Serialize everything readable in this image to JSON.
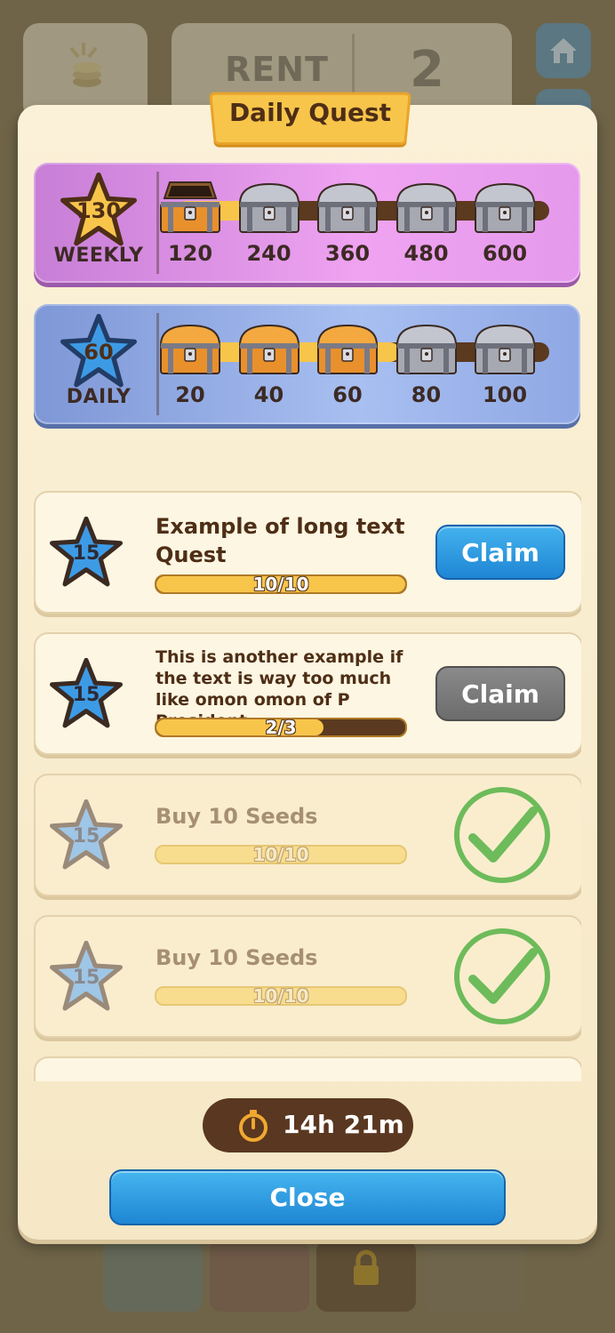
{
  "background": {
    "rent_label": "RENT",
    "rent_value": "2"
  },
  "modal": {
    "title": "Daily Quest",
    "weekly": {
      "points": "130",
      "label": "WEEKLY",
      "progress_fraction": 0.2,
      "milestones": [
        {
          "value": "120",
          "chest": "open"
        },
        {
          "value": "240",
          "chest": "silver"
        },
        {
          "value": "360",
          "chest": "silver"
        },
        {
          "value": "480",
          "chest": "silver"
        },
        {
          "value": "600",
          "chest": "silver"
        }
      ]
    },
    "daily": {
      "points": "60",
      "label": "DAILY",
      "progress_fraction": 0.6,
      "milestones": [
        {
          "value": "20",
          "chest": "gold"
        },
        {
          "value": "40",
          "chest": "gold"
        },
        {
          "value": "60",
          "chest": "gold"
        },
        {
          "value": "80",
          "chest": "silver"
        },
        {
          "value": "100",
          "chest": "silver"
        }
      ]
    },
    "quests": [
      {
        "reward": "15",
        "title": "Example of long text Quest",
        "progress": "10/10",
        "progress_fraction": 1.0,
        "state": "claimable",
        "button": "Claim"
      },
      {
        "reward": "15",
        "title": "This is another example if the text is way too much like omon omon of P President",
        "progress": "2/3",
        "progress_fraction": 0.67,
        "state": "in-progress",
        "button": "Claim"
      },
      {
        "reward": "15",
        "title": "Buy 10 Seeds",
        "progress": "10/10",
        "progress_fraction": 1.0,
        "state": "completed"
      },
      {
        "reward": "15",
        "title": "Buy 10 Seeds",
        "progress": "10/10",
        "progress_fraction": 1.0,
        "state": "completed"
      }
    ],
    "timer": "14h 21m",
    "close_label": "Close"
  },
  "colors": {
    "accent_blue": "#1f86d4",
    "gold": "#f8c54b",
    "brown": "#5b3a1f",
    "check_green": "#6dbb5a"
  }
}
